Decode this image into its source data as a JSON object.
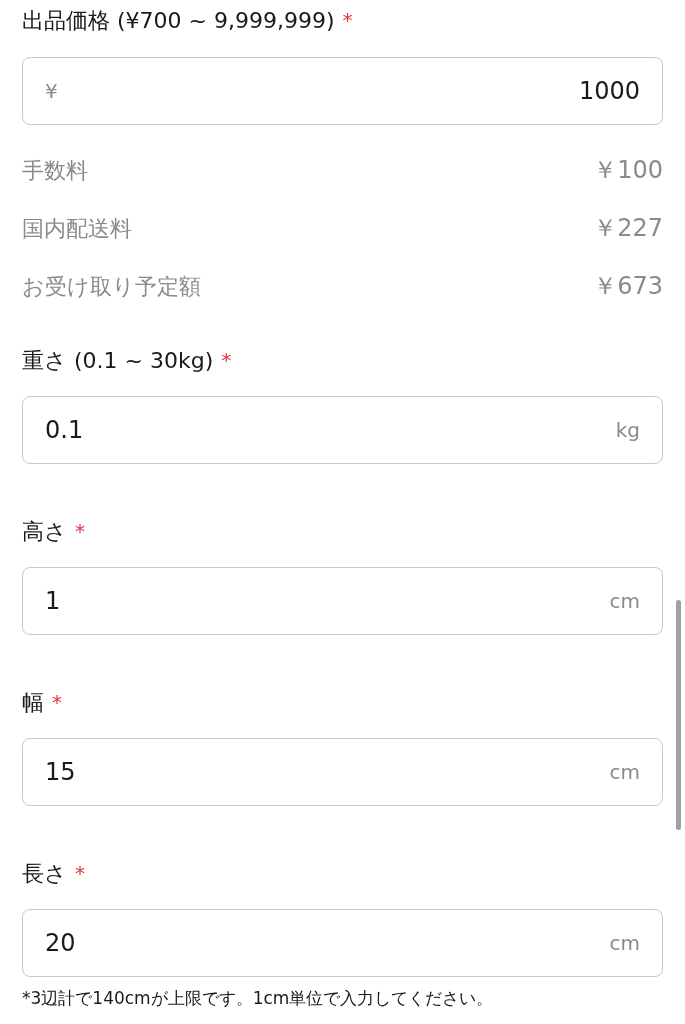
{
  "price": {
    "label": "出品価格 (¥700 ~ 9,999,999)",
    "asterisk": "*",
    "currency": "¥",
    "value": "1000"
  },
  "fees": [
    {
      "label": "手数料",
      "amount": "￥100"
    },
    {
      "label": "国内配送料",
      "amount": "￥227"
    },
    {
      "label": "お受け取り予定額",
      "amount": "￥673"
    }
  ],
  "fields": [
    {
      "label": "重さ (0.1 ~ 30kg)",
      "asterisk": "*",
      "value": "0.1",
      "unit": "kg"
    },
    {
      "label": "高さ",
      "asterisk": "*",
      "value": "1",
      "unit": "cm"
    },
    {
      "label": "幅",
      "asterisk": "*",
      "value": "15",
      "unit": "cm"
    },
    {
      "label": "長さ",
      "asterisk": "*",
      "value": "20",
      "unit": "cm"
    }
  ],
  "note": "*3辺計で140cmが上限です。1cm単位で入力してください。"
}
